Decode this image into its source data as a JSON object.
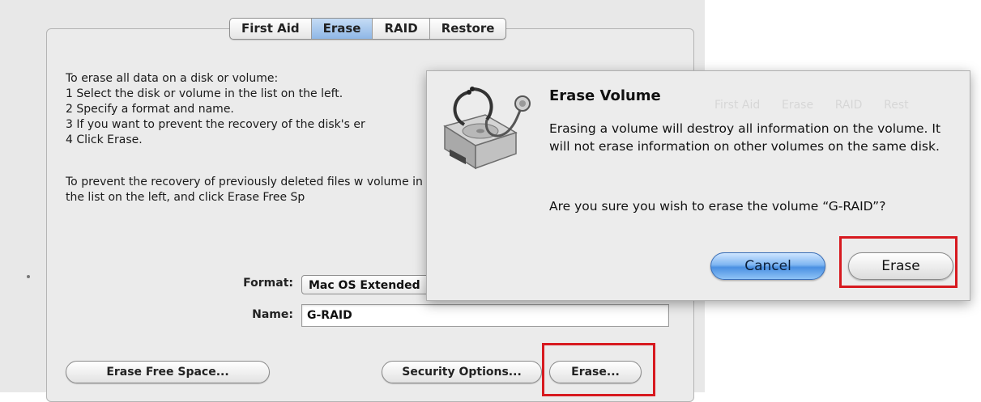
{
  "tabs": [
    {
      "label": "First Aid"
    },
    {
      "label": "Erase"
    },
    {
      "label": "RAID"
    },
    {
      "label": "Restore"
    }
  ],
  "instructions": {
    "lines": "To erase all data on a disk or volume:\n1 Select the disk or volume in the list on the left.\n2 Specify a format and name.\n3 If you want to prevent the recovery of the disk's er\n4 Click Erase.",
    "free_space": "To prevent the recovery of previously deleted files w volume in the list on the left, and click Erase Free Sp"
  },
  "form": {
    "format_label": "Format:",
    "format_value": "Mac OS Extended",
    "name_label": "Name:",
    "name_value": "G-RAID"
  },
  "buttons": {
    "erase_free_space": "Erase Free Space...",
    "security_options": "Security Options...",
    "erase": "Erase..."
  },
  "dialog": {
    "title": "Erase Volume",
    "message": "Erasing a volume will destroy all information on the volume. It will not erase information on other volumes on the same disk.",
    "question": "Are you sure you wish to erase the volume “G-RAID”?",
    "cancel_label": "Cancel",
    "erase_label": "Erase"
  },
  "colors": {
    "highlight": "#d7191f",
    "default_button": "#4a90e2"
  }
}
